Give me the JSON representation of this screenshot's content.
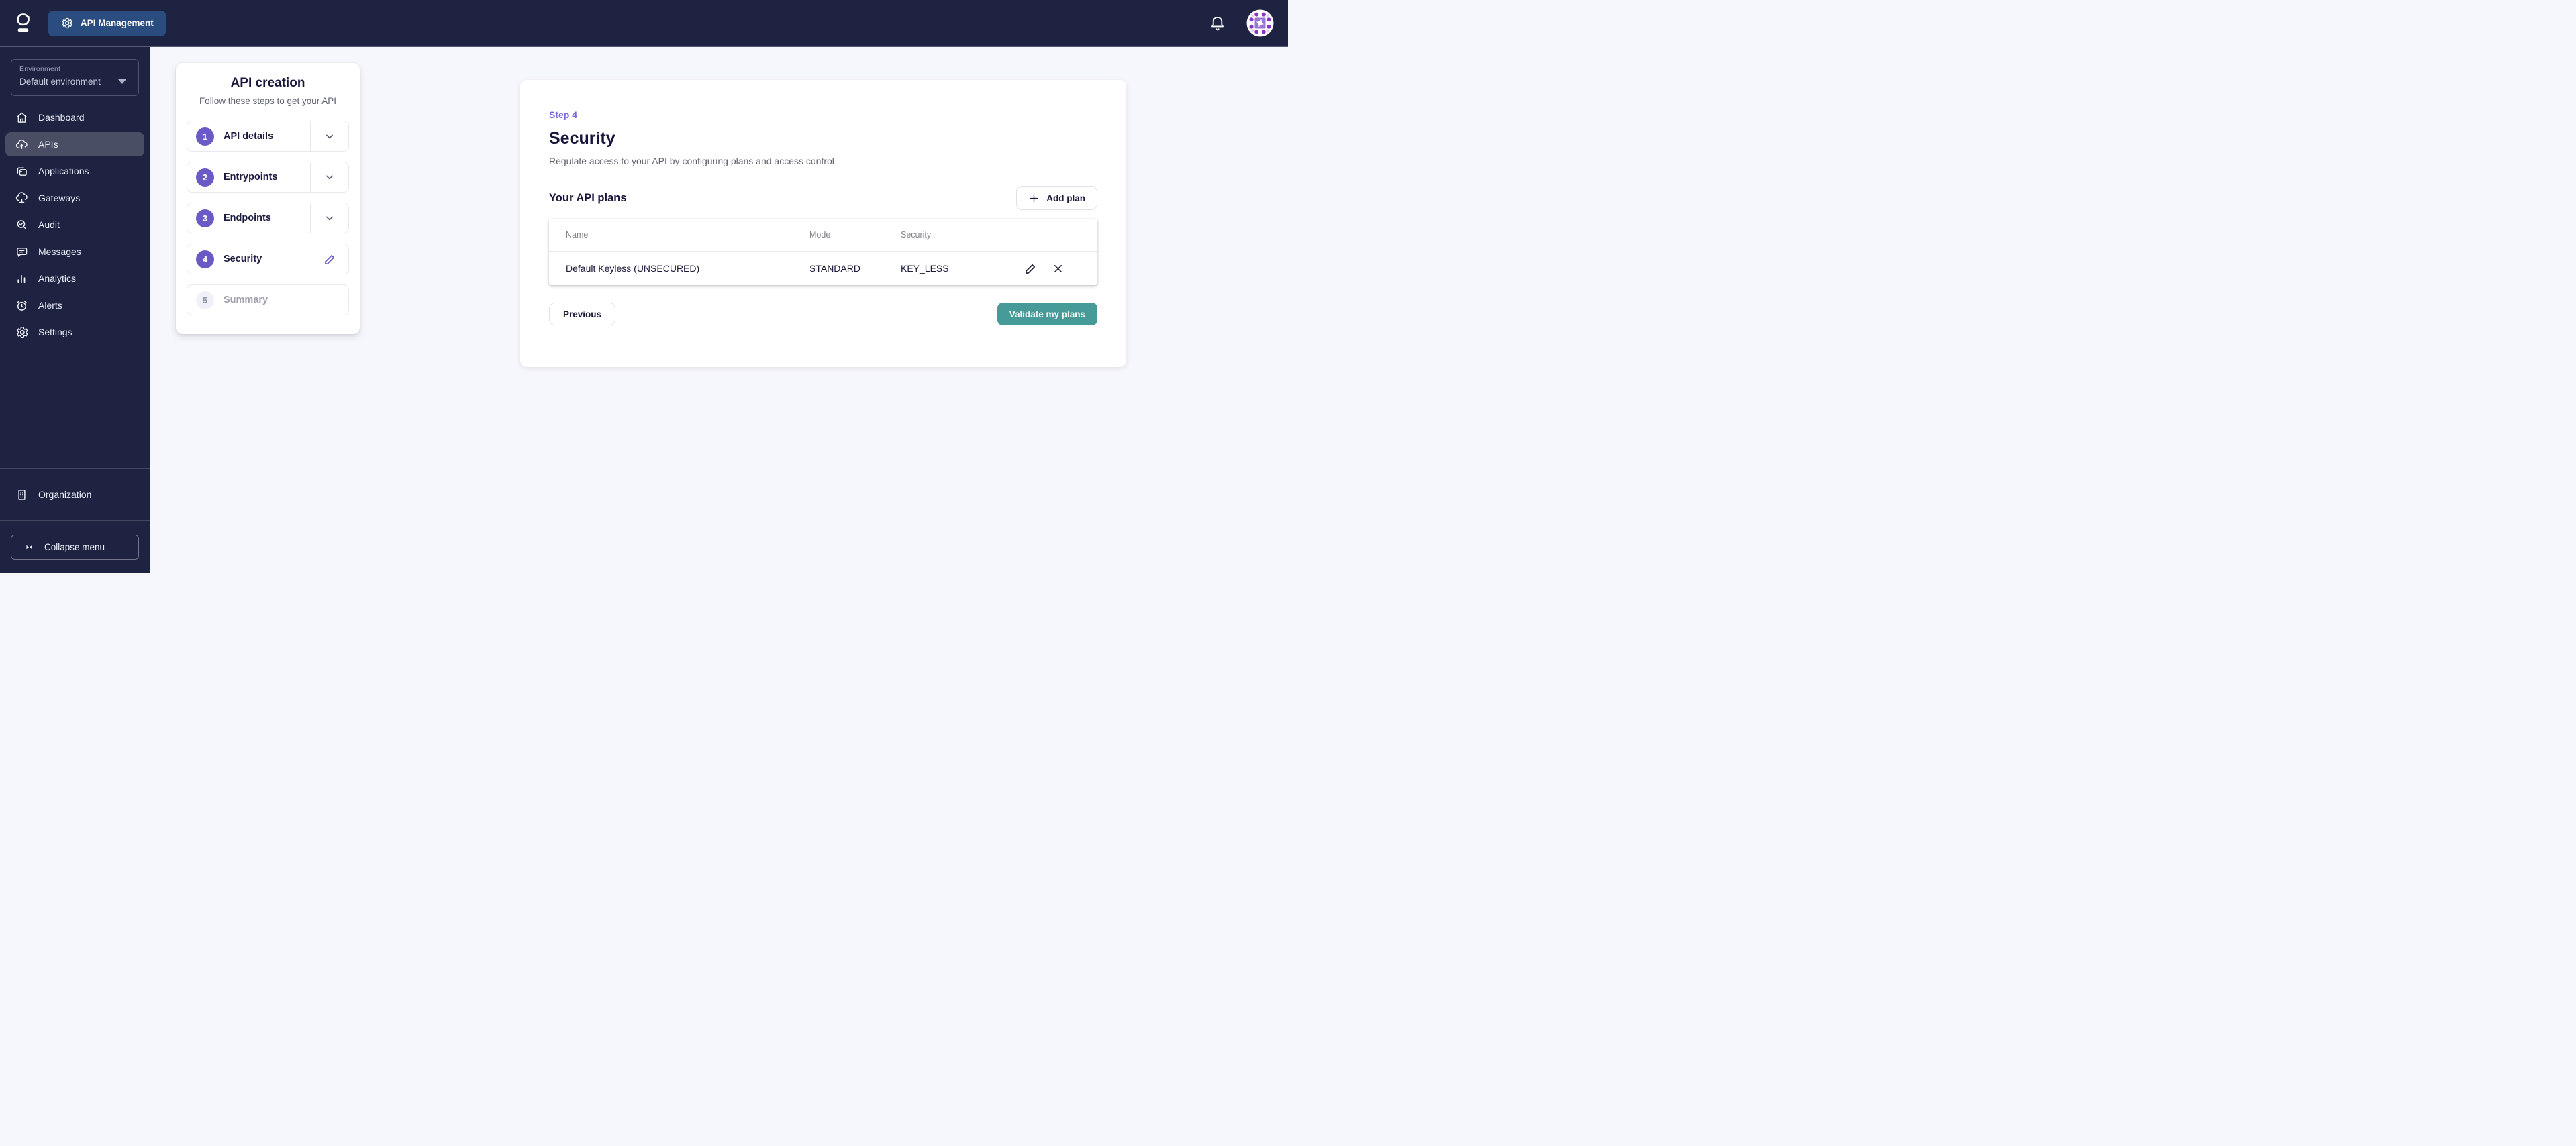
{
  "topbar": {
    "product_label": "API Management"
  },
  "sidebar": {
    "environment": {
      "label": "Environment",
      "value": "Default environment"
    },
    "items": [
      {
        "label": "Dashboard",
        "icon": "home-icon"
      },
      {
        "label": "APIs",
        "icon": "cloud-upload-icon",
        "active": true
      },
      {
        "label": "Applications",
        "icon": "applications-icon"
      },
      {
        "label": "Gateways",
        "icon": "cloud-gateway-icon"
      },
      {
        "label": "Audit",
        "icon": "audit-search-icon"
      },
      {
        "label": "Messages",
        "icon": "message-icon"
      },
      {
        "label": "Analytics",
        "icon": "bar-chart-icon"
      },
      {
        "label": "Alerts",
        "icon": "alarm-icon"
      },
      {
        "label": "Settings",
        "icon": "gear-icon"
      }
    ],
    "organization_label": "Organization",
    "collapse_label": "Collapse menu"
  },
  "stepper": {
    "title": "API creation",
    "subtitle": "Follow these steps to get your API",
    "steps": [
      {
        "number": "1",
        "label": "API details"
      },
      {
        "number": "2",
        "label": "Entrypoints"
      },
      {
        "number": "3",
        "label": "Endpoints"
      },
      {
        "number": "4",
        "label": "Security"
      },
      {
        "number": "5",
        "label": "Summary"
      }
    ]
  },
  "main": {
    "step_label": "Step 4",
    "title": "Security",
    "description": "Regulate access to your API by configuring plans and access control",
    "plans_heading": "Your API plans",
    "add_plan_label": "Add plan",
    "table": {
      "columns": [
        "Name",
        "Mode",
        "Security"
      ],
      "rows": [
        {
          "name": "Default Keyless (UNSECURED)",
          "mode": "STANDARD",
          "security": "KEY_LESS"
        }
      ]
    },
    "previous_label": "Previous",
    "validate_label": "Validate my plans"
  },
  "colors": {
    "topbar_bg": "#1e2342",
    "badge_blue": "#2b4c7e",
    "accent_purple": "#6a5ac6",
    "step_tag_purple": "#7767e0",
    "validate_teal": "#469a98",
    "page_bg": "#f6f7fc",
    "active_nav_bg": "#4a4e64"
  }
}
